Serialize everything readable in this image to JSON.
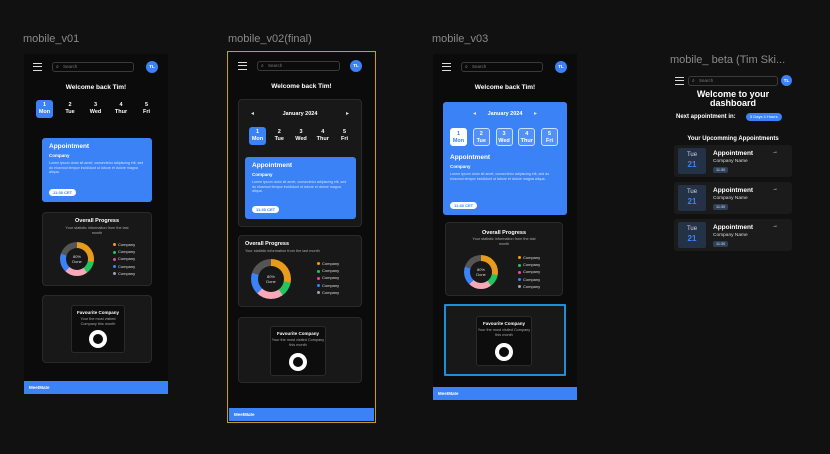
{
  "frames": {
    "v01": "mobile_v01",
    "v02": "mobile_v02(final)",
    "v03": "mobile_v03",
    "beta": "mobile_ beta (Tim Ski..."
  },
  "common": {
    "search_placeholder": "Search",
    "avatar": "TL",
    "welcome": "Welcome back Tim!",
    "brand": "MeetMate",
    "appointment_title": "Appointment",
    "appointment_company": "Company",
    "appointment_desc": "Lorem ipsum dolor sit amet, consectetur adipiscing elit, sed do eiusmod tempor incididunt ut labore et dolore magna aliqua.",
    "appointment_time": "11:30 CET",
    "progress_title": "Overall Progress",
    "progress_sub": "Your statistic information from the last month",
    "donut_pct": "80%",
    "donut_label": "Done",
    "fav_title": "Favourite Company",
    "fav_sub": "Your the most visited Company this month",
    "calendar_month": "January 2024",
    "github_icon": "github-icon"
  },
  "days": [
    {
      "num": "1",
      "name": "Mon"
    },
    {
      "num": "2",
      "name": "Tue"
    },
    {
      "num": "3",
      "name": "Wed"
    },
    {
      "num": "4",
      "name": "Thur"
    },
    {
      "num": "5",
      "name": "Fri"
    }
  ],
  "days_v01": [
    {
      "num": "1",
      "name": "Mon"
    },
    {
      "num": "2",
      "name": "Tue"
    },
    {
      "num": "3",
      "name": "Wed"
    },
    {
      "num": "4",
      "name": "Thur"
    },
    {
      "num": "5",
      "name": "Fri"
    }
  ],
  "legend": [
    "Company",
    "Company",
    "Company",
    "Company",
    "Company"
  ],
  "legend_colors": [
    "#f59e0b",
    "#22c55e",
    "#ec4899",
    "#3b82f6",
    "#9ca3af"
  ],
  "donut_colors": {
    "orange": "#e89a1c",
    "green": "#22c55e",
    "pink": "#f9a8b8",
    "blue": "#3b82f6",
    "gray": "#555555"
  },
  "beta": {
    "title": "Welcome to your dashboard",
    "next_label": "Next appointment in:",
    "next_value": "5 Days 4 Hours",
    "upcoming_title": "Your Upcomming Appointments",
    "rows": [
      {
        "day": "Tue",
        "num": "21",
        "title": "Appointment",
        "company": "Company Name",
        "time": "11:30"
      },
      {
        "day": "Tue",
        "num": "21",
        "title": "Appointment",
        "company": "Company Name",
        "time": "11:30"
      },
      {
        "day": "Tue",
        "num": "21",
        "title": "Appointment",
        "company": "Company Name",
        "time": "11:30"
      }
    ]
  },
  "colors": {
    "accent": "#3b82f6",
    "selected_outline": "#c79b22",
    "highlight_outline": "#1d8fd8"
  }
}
